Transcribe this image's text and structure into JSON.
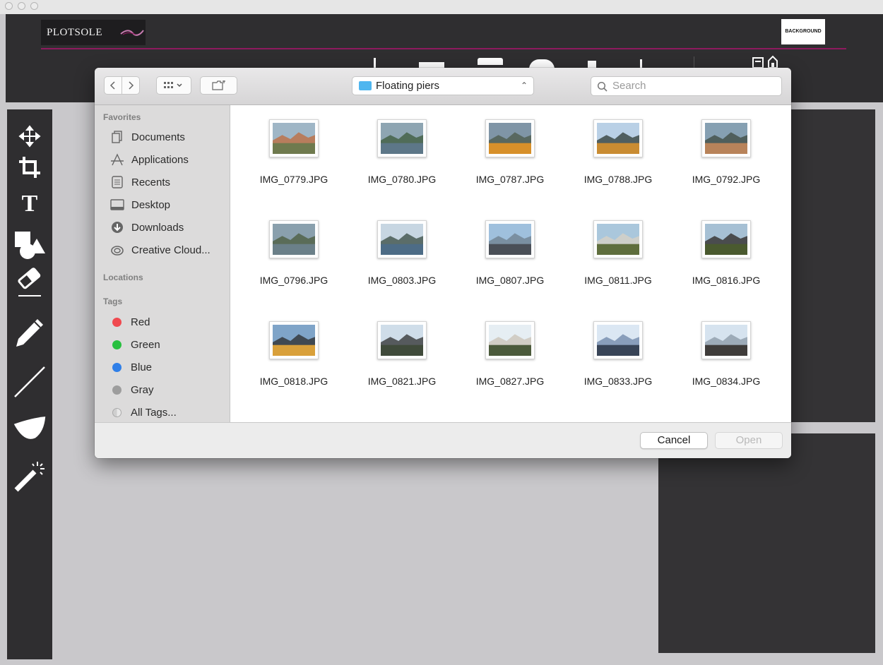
{
  "app": {
    "logo_text": "PLOTSOLE",
    "background_button": "BACKGROUND"
  },
  "tools": [
    "move-icon",
    "crop-icon",
    "text-icon",
    "shapes-icon",
    "eraser-icon",
    "pencil-icon",
    "line-icon",
    "fill-icon",
    "magic-wand-icon"
  ],
  "dialog": {
    "location": "Floating piers",
    "search_placeholder": "Search",
    "sidebar": {
      "favorites_heading": "Favorites",
      "favorites": [
        {
          "label": "Documents",
          "icon": "documents-icon"
        },
        {
          "label": "Applications",
          "icon": "applications-icon"
        },
        {
          "label": "Recents",
          "icon": "recents-icon"
        },
        {
          "label": "Desktop",
          "icon": "desktop-icon"
        },
        {
          "label": "Downloads",
          "icon": "downloads-icon"
        },
        {
          "label": "Creative Cloud...",
          "icon": "creative-cloud-icon"
        }
      ],
      "locations_heading": "Locations",
      "tags_heading": "Tags",
      "tags": [
        {
          "label": "Red",
          "color": "#f0494f"
        },
        {
          "label": "Green",
          "color": "#28c03f"
        },
        {
          "label": "Blue",
          "color": "#2f7fe8"
        },
        {
          "label": "Gray",
          "color": "#9d9d9d"
        },
        {
          "label": "All Tags...",
          "color": ""
        }
      ]
    },
    "files": [
      {
        "name": "IMG_0779.JPG",
        "sky": "#9fb6c6",
        "ground": "#6f7a4e",
        "accent": "#c06a3a"
      },
      {
        "name": "IMG_0780.JPG",
        "sky": "#8ea5b2",
        "ground": "#5d7788",
        "accent": "#3b5a3a"
      },
      {
        "name": "IMG_0787.JPG",
        "sky": "#7f95a6",
        "ground": "#d7902a",
        "accent": "#4b5a48"
      },
      {
        "name": "IMG_0788.JPG",
        "sky": "#b9d0e6",
        "ground": "#c98c32",
        "accent": "#2e3a33"
      },
      {
        "name": "IMG_0792.JPG",
        "sky": "#86a0b2",
        "ground": "#b8835a",
        "accent": "#3d4a3f"
      },
      {
        "name": "IMG_0796.JPG",
        "sky": "#8aa0ad",
        "ground": "#6b8089",
        "accent": "#4a5b3c"
      },
      {
        "name": "IMG_0803.JPG",
        "sky": "#c7d6e2",
        "ground": "#4d6c86",
        "accent": "#374a40"
      },
      {
        "name": "IMG_0807.JPG",
        "sky": "#9fc0dd",
        "ground": "#4a4f57",
        "accent": "#6d7f8c"
      },
      {
        "name": "IMG_0811.JPG",
        "sky": "#aac7dc",
        "ground": "#5f6e3d",
        "accent": "#d9d2c4"
      },
      {
        "name": "IMG_0816.JPG",
        "sky": "#a6c0d4",
        "ground": "#4a5a2f",
        "accent": "#2b2622"
      },
      {
        "name": "IMG_0818.JPG",
        "sky": "#7fa4c8",
        "ground": "#d9a03a",
        "accent": "#2b2b2b"
      },
      {
        "name": "IMG_0821.JPG",
        "sky": "#cfdde9",
        "ground": "#3f4a3a",
        "accent": "#2d2d2d"
      },
      {
        "name": "IMG_0827.JPG",
        "sky": "#e6eef3",
        "ground": "#4b5a3b",
        "accent": "#c9c2b6"
      },
      {
        "name": "IMG_0833.JPG",
        "sky": "#dbe7f3",
        "ground": "#384457",
        "accent": "#6e86a8"
      },
      {
        "name": "IMG_0834.JPG",
        "sky": "#d6e3ef",
        "ground": "#3f3c3a",
        "accent": "#8a98a6"
      }
    ],
    "cancel_label": "Cancel",
    "open_label": "Open"
  }
}
